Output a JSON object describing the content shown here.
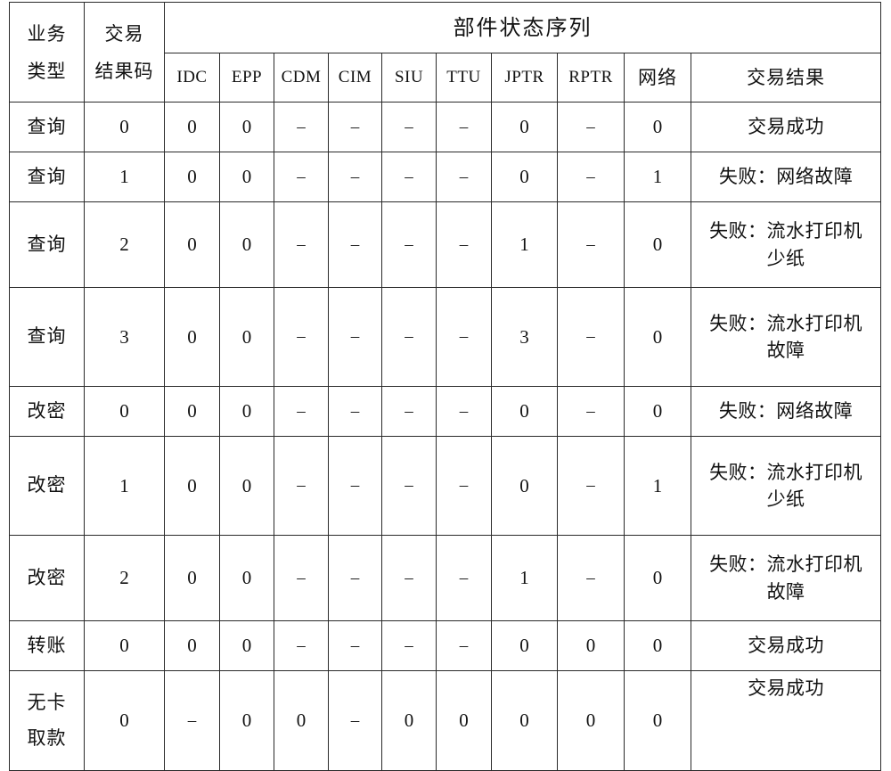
{
  "table": {
    "header": {
      "col_biz_type_line1": "业务",
      "col_biz_type_line2": "类型",
      "col_result_code_line1": "交易",
      "col_result_code_line2": "结果码",
      "group_label": "部件状态序列",
      "components": [
        "IDC",
        "EPP",
        "CDM",
        "CIM",
        "SIU",
        "TTU",
        "JPTR",
        "RPTR",
        "网络"
      ],
      "col_transaction_result": "交易结果"
    },
    "rows": [
      {
        "biz_type": "查询",
        "biz_type_lines": [
          "查询"
        ],
        "result_code": "0",
        "components": [
          "0",
          "0",
          "–",
          "–",
          "–",
          "–",
          "0",
          "–",
          "0"
        ],
        "result": "交易成功",
        "result_lines": [
          "交易成功"
        ],
        "height": "short"
      },
      {
        "biz_type": "查询",
        "biz_type_lines": [
          "查询"
        ],
        "result_code": "1",
        "components": [
          "0",
          "0",
          "–",
          "–",
          "–",
          "–",
          "0",
          "–",
          "1"
        ],
        "result": "失败：网络故障",
        "result_lines": [
          "失败：网络故障"
        ],
        "height": "short"
      },
      {
        "biz_type": "查询",
        "biz_type_lines": [
          "查询"
        ],
        "result_code": "2",
        "components": [
          "0",
          "0",
          "–",
          "–",
          "–",
          "–",
          "1",
          "–",
          "0"
        ],
        "result": "失败：流水打印机少纸",
        "result_lines": [
          "失败：流水打印机",
          "少纸"
        ],
        "height": "medium"
      },
      {
        "biz_type": "查询",
        "biz_type_lines": [
          "查询"
        ],
        "result_code": "3",
        "components": [
          "0",
          "0",
          "–",
          "–",
          "–",
          "–",
          "3",
          "–",
          "0"
        ],
        "result": "失败：流水打印机故障",
        "result_lines": [
          "失败：流水打印机",
          "故障"
        ],
        "height": "large"
      },
      {
        "biz_type": "改密",
        "biz_type_lines": [
          "改密"
        ],
        "result_code": "0",
        "components": [
          "0",
          "0",
          "–",
          "–",
          "–",
          "–",
          "0",
          "–",
          "0"
        ],
        "result": "失败：网络故障",
        "result_lines": [
          "失败：网络故障"
        ],
        "height": "short"
      },
      {
        "biz_type": "改密",
        "biz_type_lines": [
          "改密"
        ],
        "result_code": "1",
        "components": [
          "0",
          "0",
          "–",
          "–",
          "–",
          "–",
          "0",
          "–",
          "1"
        ],
        "result": "失败：流水打印机少纸",
        "result_lines": [
          "失败：流水打印机",
          "少纸"
        ],
        "height": "large"
      },
      {
        "biz_type": "改密",
        "biz_type_lines": [
          "改密"
        ],
        "result_code": "2",
        "components": [
          "0",
          "0",
          "–",
          "–",
          "–",
          "–",
          "1",
          "–",
          "0"
        ],
        "result": "失败：流水打印机故障",
        "result_lines": [
          "失败：流水打印机",
          "故障"
        ],
        "height": "medium"
      },
      {
        "biz_type": "转账",
        "biz_type_lines": [
          "转账"
        ],
        "result_code": "0",
        "components": [
          "0",
          "0",
          "–",
          "–",
          "–",
          "–",
          "0",
          "0",
          "0"
        ],
        "result": "交易成功",
        "result_lines": [
          "交易成功"
        ],
        "height": "short"
      },
      {
        "biz_type": "无卡取款",
        "biz_type_lines": [
          "无卡",
          "取款"
        ],
        "result_code": "0",
        "components": [
          "–",
          "0",
          "0",
          "–",
          "0",
          "0",
          "0",
          "0",
          "0"
        ],
        "result": "交易成功",
        "result_lines": [
          "交易成功"
        ],
        "height": "tall"
      }
    ]
  }
}
